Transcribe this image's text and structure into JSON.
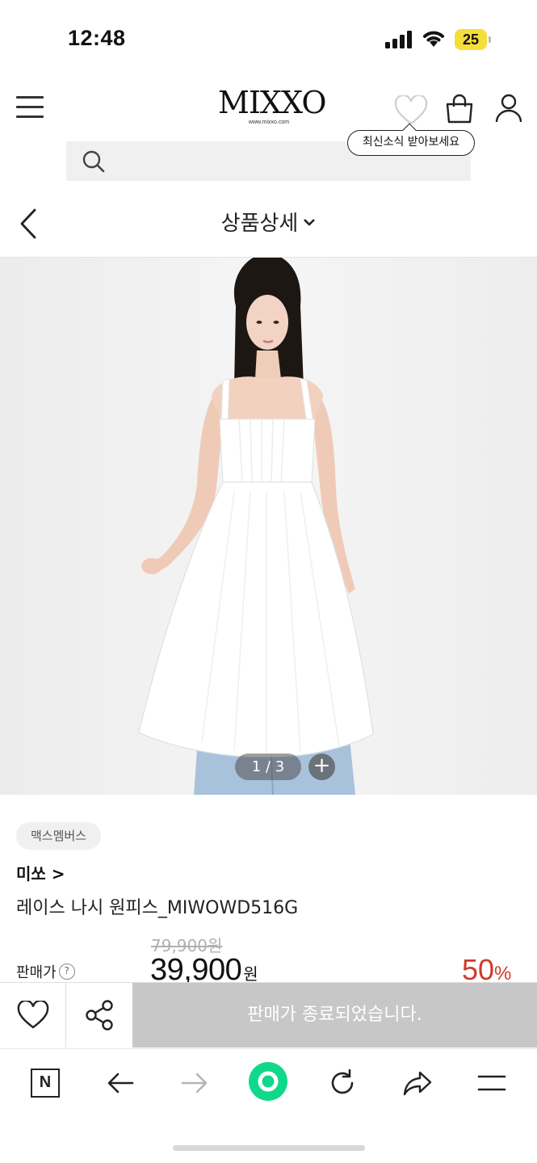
{
  "status_bar": {
    "time": "12:48",
    "battery": "25"
  },
  "header": {
    "logo": "MIXXO",
    "logo_sub": "www.mixxo.com",
    "tooltip": "최신소식 받아보세요"
  },
  "nav": {
    "title": "상품상세"
  },
  "gallery": {
    "counter": "1 / 3",
    "zoom": "+"
  },
  "product": {
    "badge": "맥스멤버스",
    "brand": "미쏘 >",
    "name": "레이스 나시 원피스_MIWOWD516G",
    "original_price": "79,900원",
    "price_label": "판매가",
    "sale_price": "39,900",
    "sale_unit": "원",
    "discount": "50",
    "discount_unit": "%"
  },
  "bottom_bar": {
    "soldout": "판매가 종료되었습니다."
  },
  "browser": {
    "home_label": "N"
  },
  "colors": {
    "discount": "#d03a2b",
    "soldout_bg": "#c7c7c7",
    "battery": "#f5dd3a",
    "toolbar_accent": "#10d88a"
  }
}
